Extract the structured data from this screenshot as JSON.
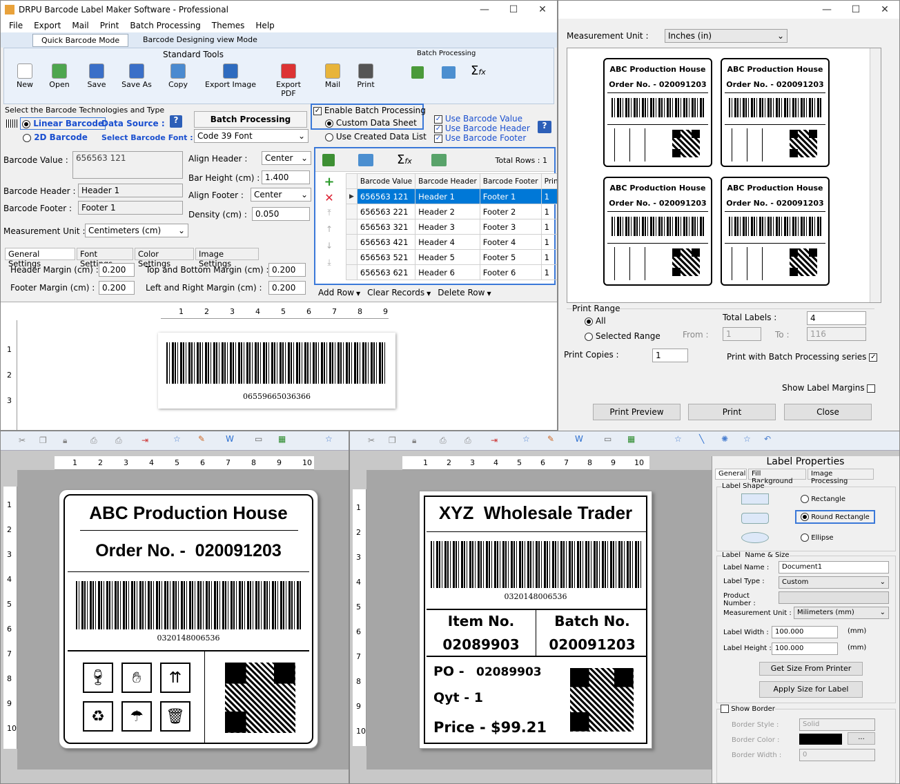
{
  "app": {
    "title": "DRPU Barcode Label Maker Software - Professional",
    "menu": [
      "File",
      "Export",
      "Mail",
      "Print",
      "Batch Processing",
      "Themes",
      "Help"
    ],
    "mode_tabs": [
      "Quick Barcode Mode",
      "Barcode Designing view Mode"
    ],
    "standard_tools_label": "Standard Tools",
    "batch_processing_label": "Batch Processing",
    "tools": [
      "New",
      "Open",
      "Save",
      "Save As",
      "Copy",
      "Export Image",
      "Export PDF",
      "Mail",
      "Print"
    ]
  },
  "tech": {
    "section_label": "Select the Barcode Technologies and Type",
    "linear": "Linear Barcode",
    "twod": "2D Barcode",
    "data_source": "Data Source :",
    "select_font": "Select Barcode Font :",
    "batch_btn": "Batch Processing",
    "font_value": "Code 39 Font",
    "enable_batch": "Enable Batch Processing",
    "custom_sheet": "Custom Data Sheet",
    "created_list": "Use Created Data List",
    "use_value": "Use Barcode Value",
    "use_header": "Use Barcode Header",
    "use_footer": "Use Barcode Footer"
  },
  "form": {
    "barcode_value_label": "Barcode Value :",
    "barcode_value": "656563 121",
    "header_label": "Barcode Header :",
    "header_value": "Header 1",
    "footer_label": "Barcode Footer :",
    "footer_value": "Footer 1",
    "unit_label": "Measurement Unit :",
    "unit_value": "Centimeters (cm)",
    "align_header_label": "Align Header :",
    "align_header": "Center",
    "bar_height_label": "Bar Height (cm) :",
    "bar_height": "1.400",
    "align_footer_label": "Align Footer :",
    "align_footer": "Center",
    "density_label": "Density (cm) :",
    "density": "0.050",
    "settings_tabs": [
      "General Settings",
      "Font Settings",
      "Color Settings",
      "Image Settings"
    ],
    "header_margin_label": "Header Margin (cm) :",
    "header_margin": "0.200",
    "footer_margin_label": "Footer Margin (cm) :",
    "footer_margin": "0.200",
    "tb_margin_label": "Top and Bottom Margin (cm) :",
    "tb_margin": "0.200",
    "lr_margin_label": "Left and Right Margin (cm) :",
    "lr_margin": "0.200"
  },
  "grid": {
    "total_rows": "Total Rows : 1",
    "headers": [
      "Barcode Value",
      "Barcode Header",
      "Barcode Footer",
      "Print Quantity"
    ],
    "rows": [
      [
        "656563 121",
        "Header 1",
        "Footer 1",
        "1"
      ],
      [
        "656563 221",
        "Header 2",
        "Footer 2",
        "1"
      ],
      [
        "656563 321",
        "Header 3",
        "Footer 3",
        "1"
      ],
      [
        "656563 421",
        "Header 4",
        "Footer 4",
        "1"
      ],
      [
        "656563 521",
        "Header 5",
        "Footer 5",
        "1"
      ],
      [
        "656563 621",
        "Header 6",
        "Footer 6",
        "1"
      ]
    ],
    "actions": [
      "Add Row",
      "Clear Records",
      "Delete Row"
    ]
  },
  "preview": {
    "barcode_text": "06559665036366",
    "ruler_top": [
      "1",
      "2",
      "3",
      "4",
      "5",
      "6",
      "7",
      "8",
      "9"
    ],
    "ruler_left": [
      "1",
      "2",
      "3"
    ]
  },
  "print_dialog": {
    "unit_label": "Measurement Unit :",
    "unit_value": "Inches (in)",
    "label_title": "ABC Production House",
    "label_order": "Order No. - 020091203",
    "print_range": "Print Range",
    "all": "All",
    "selected_range": "Selected Range",
    "from_label": "From :",
    "from_value": "1",
    "to_label": "To :",
    "to_value": "116",
    "total_labels_label": "Total Labels :",
    "total_labels": "4",
    "copies_label": "Print Copies :",
    "copies": "1",
    "batch_series": "Print with Batch Processing series",
    "show_margins": "Show Label Margins",
    "btn_preview": "Print Preview",
    "btn_print": "Print",
    "btn_close": "Close"
  },
  "designer1": {
    "ruler_top": [
      "1",
      "2",
      "3",
      "4",
      "5",
      "6",
      "7",
      "8",
      "9",
      "10"
    ],
    "ruler_left": [
      "1",
      "2",
      "3",
      "4",
      "5",
      "6",
      "7",
      "8",
      "9",
      "10"
    ],
    "title": "ABC Production House",
    "order": "Order No. -  020091203",
    "barcode_text": "0320148006536"
  },
  "designer2": {
    "ruler_top": [
      "1",
      "2",
      "3",
      "4",
      "5",
      "6",
      "7",
      "8",
      "9",
      "10"
    ],
    "ruler_left": [
      "1",
      "2",
      "3",
      "4",
      "5",
      "6",
      "7",
      "8",
      "9",
      "10"
    ],
    "title": "XYZ  Wholesale Trader",
    "barcode_text": "0320148006536",
    "item_label": "Item No.",
    "item_value": "02089903",
    "batch_label": "Batch No.",
    "batch_value": "020091203",
    "po_label": "PO -",
    "po_value": "02089903",
    "qty": "Qyt - 1",
    "price": "Price - $99.21"
  },
  "props": {
    "title": "Label Properties",
    "tabs": [
      "General",
      "Fill Background",
      "Image Processing"
    ],
    "shape_label": "Label Shape",
    "rect": "Rectangle",
    "round_rect": "Round Rectangle",
    "ellipse": "Ellipse",
    "name_size_label": "Label  Name & Size",
    "name_label": "Label Name :",
    "name_value": "Document1",
    "type_label": "Label Type :",
    "type_value": "Custom",
    "product_label": "Product Number :",
    "unit_label": "Measurement Unit :",
    "unit_value": "Milimeters (mm)",
    "width_label": "Label Width :",
    "width_value": "100.000",
    "height_label": "Label Height :",
    "height_value": "100.000",
    "mm": "(mm)",
    "get_size": "Get Size From Printer",
    "apply_size": "Apply Size for Label",
    "show_border": "Show Border",
    "border_style_label": "Border Style :",
    "border_style": "Solid",
    "border_color_label": "Border Color :",
    "border_width_label": "Border Width :",
    "border_width": "0"
  }
}
